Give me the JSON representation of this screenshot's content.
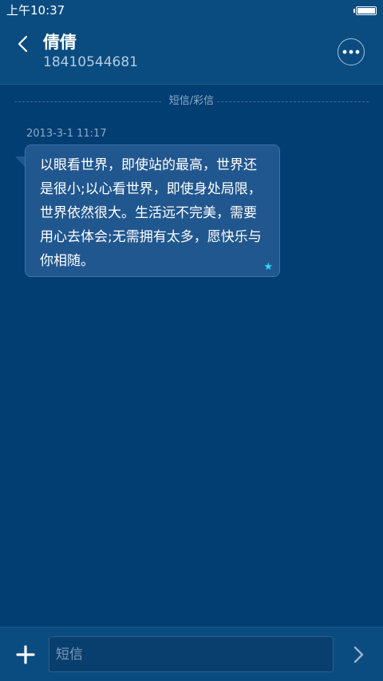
{
  "status_bar": {
    "time": "上午10:37",
    "battery_level": 1.0
  },
  "header": {
    "contact_name": "倩倩",
    "contact_number": "18410544681",
    "icons": {
      "back": "chevron-left-icon",
      "more": "more-horizontal-icon"
    }
  },
  "conversation": {
    "divider_label": "短信/彩信",
    "messages": [
      {
        "timestamp": "2013-3-1 11:17",
        "text": "以眼看世界，即使站的最高，世界还是很小;以心看世界，即使身处局限，世界依然很大。生活远不完美，需要用心去体会;无需拥有太多，愿快乐与你相随。",
        "starred": true,
        "star_symbol": "★"
      }
    ]
  },
  "input_bar": {
    "placeholder": "短信",
    "value": "",
    "icons": {
      "add": "plus-icon",
      "send": "chevron-right-icon"
    }
  },
  "colors": {
    "background": "#023e72",
    "bar_background": "#0a4c80",
    "bubble_background": "#21578f",
    "star_accent": "#2fd8f0",
    "secondary_text": "#8eaac6"
  }
}
